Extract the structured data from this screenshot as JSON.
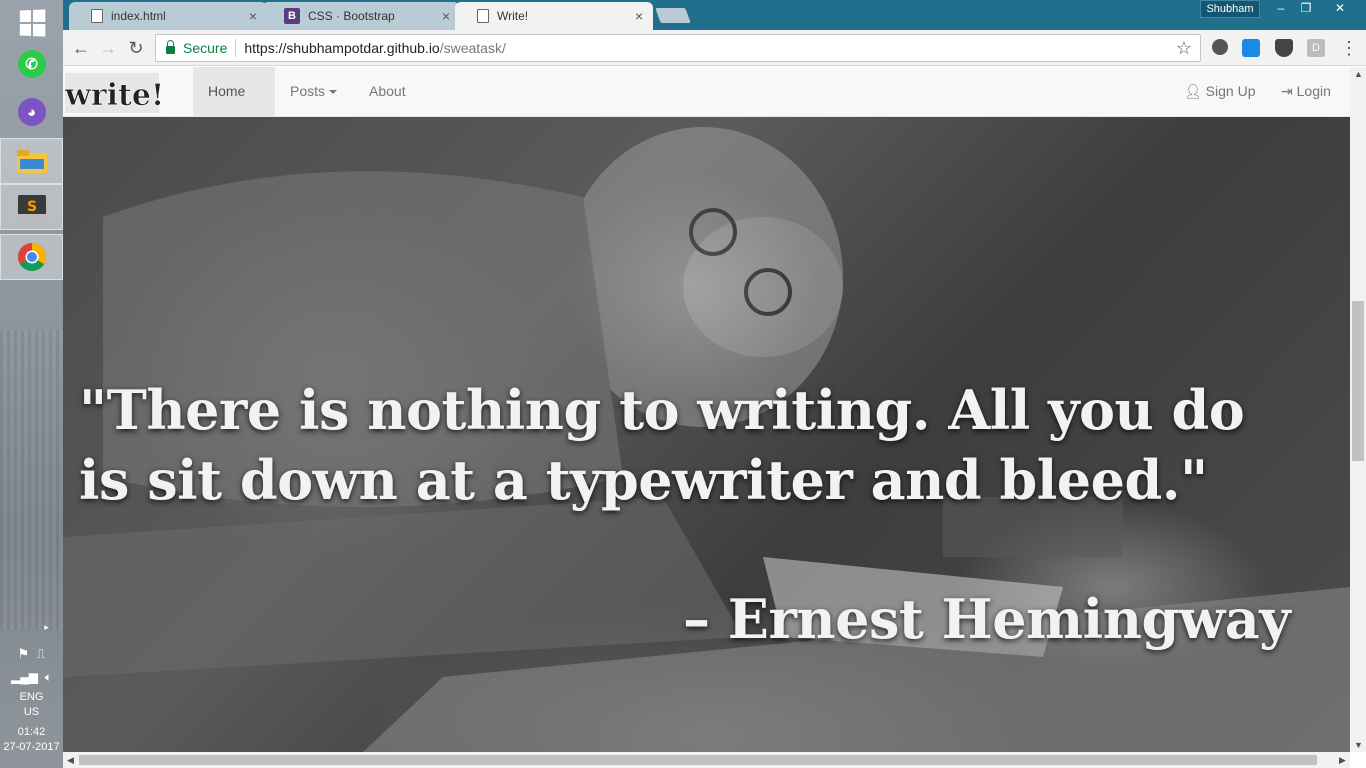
{
  "taskbar": {
    "icons": [
      "windows-start-icon",
      "whatsapp-icon",
      "github-cat-icon",
      "file-explorer-icon",
      "sublime-text-icon",
      "chrome-icon"
    ],
    "tray": {
      "language": "ENG",
      "region": "US",
      "time": "01:42",
      "date": "27-07-2017"
    }
  },
  "browser": {
    "tabs": [
      {
        "title": "index.html",
        "close": "×"
      },
      {
        "title": "CSS · Bootstrap",
        "close": "×",
        "favicon_letter": "B"
      },
      {
        "title": "Write!",
        "close": "×"
      }
    ],
    "profile_name": "Shubham",
    "window_controls": {
      "minimize": "–",
      "restore": "❐",
      "close": "✕"
    },
    "omnibox": {
      "secure_label": "Secure",
      "url_scheme_host": "https://shubhampotdar.github.io",
      "url_path": "/sweatask/"
    },
    "extension_letter": "D"
  },
  "navbar": {
    "brand": "write!",
    "links": {
      "home": "Home",
      "posts": "Posts",
      "about": "About"
    },
    "signup": "Sign Up",
    "login": "Login"
  },
  "hero": {
    "quote": "\"There is nothing to writing. All you do is sit down at a typewriter and bleed.\"",
    "author": "– Ernest Hemingway"
  },
  "colors": {
    "tabbar": "#20708d",
    "secure_green": "#0b8043",
    "bootstrap_purple": "#563d7c",
    "navbar_bg": "#f8f8f8"
  }
}
